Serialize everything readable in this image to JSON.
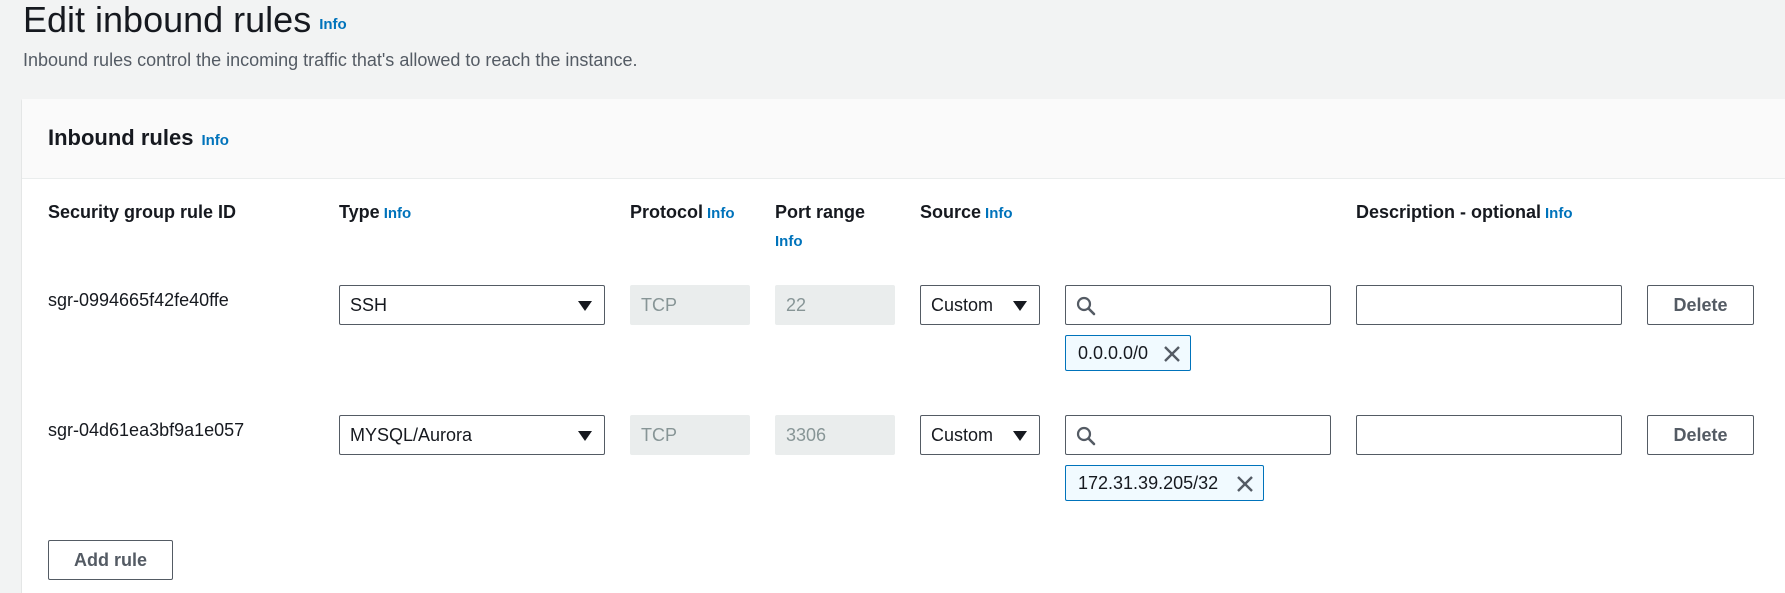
{
  "page": {
    "title": "Edit inbound rules",
    "title_info": "Info",
    "description": "Inbound rules control the incoming traffic that's allowed to reach the instance."
  },
  "panel": {
    "title": "Inbound rules",
    "title_info": "Info"
  },
  "columns": {
    "rule_id": "Security group rule ID",
    "type": "Type",
    "type_info": "Info",
    "protocol": "Protocol",
    "protocol_info": "Info",
    "port_range": "Port range",
    "port_range_info": "Info",
    "source": "Source",
    "source_info": "Info",
    "description": "Description - optional",
    "description_info": "Info"
  },
  "rules": [
    {
      "id": "sgr-0994665f42fe40ffe",
      "type": "SSH",
      "protocol": "TCP",
      "port_range": "22",
      "source_type": "Custom",
      "source_search_value": "",
      "source_token": "0.0.0.0/0",
      "description_value": "",
      "delete_label": "Delete"
    },
    {
      "id": "sgr-04d61ea3bf9a1e057",
      "type": "MYSQL/Aurora",
      "protocol": "TCP",
      "port_range": "3306",
      "source_type": "Custom",
      "source_search_value": "",
      "source_token": "172.31.39.205/32",
      "description_value": "",
      "delete_label": "Delete"
    }
  ],
  "add_rule_label": "Add rule",
  "icons": {
    "search": "search-icon",
    "remove": "close-icon",
    "dropdown": "caret-down-icon"
  },
  "colors": {
    "link": "#0073bb",
    "token_border": "#0073bb",
    "token_bg": "#f1faff",
    "disabled_bg": "#eaeded",
    "page_bg": "#f2f3f3"
  }
}
